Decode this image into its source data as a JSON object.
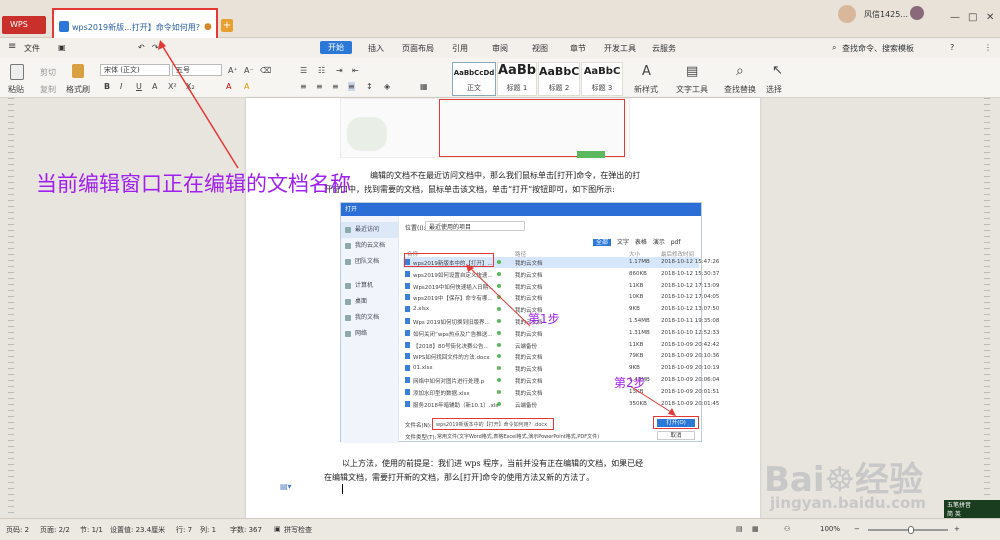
{
  "titlebar": {
    "wps_label": "WPS",
    "doc_tab_title": "wps2019新版...打开】命令如何用?",
    "modified_dot": "●",
    "new_tab": "+",
    "user_name": "风信1425..."
  },
  "menu": {
    "file": "文件",
    "tabs": [
      "开始",
      "插入",
      "页面布局",
      "引用",
      "审阅",
      "视图",
      "章节",
      "开发工具",
      "云服务"
    ],
    "search": "查找命令、搜索模板"
  },
  "ribbon": {
    "paste": "粘贴",
    "cut": "剪切",
    "copy": "复制",
    "format_painter": "格式刷",
    "font_name": "宋体 (正文)",
    "font_size": "五号",
    "styles": [
      {
        "sample": "AaBbCcDd",
        "label": "正文"
      },
      {
        "sample": "AaBb",
        "label": "标题 1"
      },
      {
        "sample": "AaBbC",
        "label": "标题 2"
      },
      {
        "sample": "AaBbC",
        "label": "标题 3"
      }
    ],
    "new_style": "新样式",
    "text_tools": "文字工具",
    "find_replace": "查找替换",
    "select": "选择"
  },
  "document": {
    "para1_line1": "编辑的文档不在最近访问文档中，那么我们鼠标单击[打开]命令，在弹出的打",
    "para1_line2": "开窗口中，找到需要的文档，鼠标单击该文档，单击“打开”按钮即可，如下图所示:",
    "para2_line1": "以上方法，使用的前提是：我们进 wps 程序，当前并没有正在编辑的文档，如果已经",
    "para2_line2": "在编辑文档，需要打开新的文档，那么[打开]命令的使用方法又新的方法了。"
  },
  "dialog": {
    "title": "打开",
    "location_label": "位置(I):",
    "location_value": "最近使用的项目",
    "filter_tabs": [
      "全部",
      "文字",
      "表格",
      "演示",
      "pdf"
    ],
    "col_name": "名称",
    "col_path": "路径",
    "col_size": "大小",
    "col_date": "最后修改时间",
    "sidebar": [
      "最近访问",
      "我的云文档",
      "团队文档",
      "计算机",
      "桌面",
      "我的文档",
      "网络"
    ],
    "files": [
      {
        "name": "wps2019新版本中的【打开】...",
        "path": "我的云文档",
        "size": "1.17MB",
        "date": "2018-10-12 15:47:26"
      },
      {
        "name": "wps2019如何设置自定义快速...",
        "path": "我的云文档",
        "size": "860KB",
        "date": "2018-10-12 15:30:37"
      },
      {
        "name": "Wps2019中如何快速插入日期...",
        "path": "我的云文档",
        "size": "11KB",
        "date": "2018-10-12 17:13:09"
      },
      {
        "name": "wps2019中【保存】命令有哪...",
        "path": "我的云文档",
        "size": "10KB",
        "date": "2018-10-12 17:04:05"
      },
      {
        "name": "2.xlsx",
        "path": "我的云文档",
        "size": "9KB",
        "date": "2018-10-12 13:07:50"
      },
      {
        "name": "Wps 2019如何切换到旧版界...",
        "path": "我的云文档",
        "size": "1.54MB",
        "date": "2018-10-11 19:35:08"
      },
      {
        "name": "如何关闭“wps热点及广告推送...",
        "path": "我的云文档",
        "size": "1.31MB",
        "date": "2018-10-10 12:52:33"
      },
      {
        "name": "【2018】80号街化决赛公告...",
        "path": "云端备份",
        "size": "11KB",
        "date": "2018-10-09 20:42:42"
      },
      {
        "name": "WPS如何找回文件的方法.docx",
        "path": "我的云文档",
        "size": "79KB",
        "date": "2018-10-09 20:10:36"
      },
      {
        "name": "01.xlsx",
        "path": "我的云文档",
        "size": "9KB",
        "date": "2018-10-09 20:10:19"
      },
      {
        "name": "网络中如何对图片进行处理.p",
        "path": "我的云文档",
        "size": "1.48MB",
        "date": "2018-10-09 20:06:04"
      },
      {
        "name": "添加水印型的数据.xlsx",
        "path": "我的云文档",
        "size": "13KB",
        "date": "2018-10-09 20:01:51"
      },
      {
        "name": "服务2018年暗辅助（新10.1）.xls",
        "path": "云端备份",
        "size": "350KB",
        "date": "2018-10-09 20:01:45"
      }
    ],
    "filename_label": "文件名(N):",
    "filename_value": "wps2019新版本中的【打开】命令如何用？.docx",
    "filetype_label": "文件类型(T):",
    "filetype_value": "常用文件(文字Word格式,表格Excel格式,演示PowerPoint格式,PDF文件)",
    "open_button": "打开(O)",
    "cancel_button": "取消"
  },
  "annotations": {
    "main": "当前编辑窗口正在编辑的文档名称",
    "step1": "第1步",
    "step2": "第2步"
  },
  "statusbar": {
    "page_num": "页码: 2",
    "pages": "页面: 2/2",
    "section": "节: 1/1",
    "position": "设置值: 23.4厘米",
    "row": "行: 7",
    "col": "列: 1",
    "words": "字数: 367",
    "spellcheck": "拼写检查",
    "zoom": "100%"
  },
  "watermark": {
    "brand": "Bai",
    "brand2": "经验",
    "url": "jingyan.baidu.com"
  },
  "ime": {
    "line1": "五笔拼音",
    "line2": "简 英"
  },
  "colors": {
    "accent": "#2b78d9",
    "annotation": "#a020f0",
    "highlight_box": "#e53935",
    "wps_red": "#c9302c"
  }
}
